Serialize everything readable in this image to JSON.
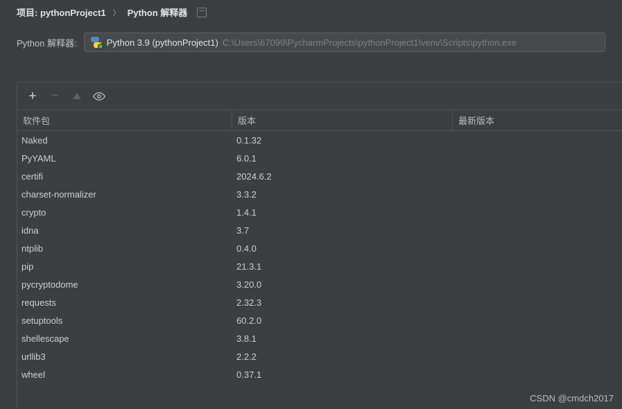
{
  "breadcrumb": {
    "project_label": "项目: pythonProject1",
    "current_page": "Python 解释器"
  },
  "interpreter": {
    "row_label": "Python 解释器:",
    "name": "Python 3.9 (pythonProject1)",
    "path": "C:\\Users\\67099\\PycharmProjects\\pythonProject1\\venv\\Scripts\\python.exe"
  },
  "toolbar": {
    "add": "+",
    "remove": "−"
  },
  "columns": {
    "package": "软件包",
    "version": "版本",
    "latest": "最新版本"
  },
  "packages": [
    {
      "name": "Naked",
      "version": "0.1.32"
    },
    {
      "name": "PyYAML",
      "version": "6.0.1"
    },
    {
      "name": "certifi",
      "version": "2024.6.2"
    },
    {
      "name": "charset-normalizer",
      "version": "3.3.2"
    },
    {
      "name": "crypto",
      "version": "1.4.1"
    },
    {
      "name": "idna",
      "version": "3.7"
    },
    {
      "name": "ntplib",
      "version": "0.4.0"
    },
    {
      "name": "pip",
      "version": "21.3.1"
    },
    {
      "name": "pycryptodome",
      "version": "3.20.0"
    },
    {
      "name": "requests",
      "version": "2.32.3"
    },
    {
      "name": "setuptools",
      "version": "60.2.0"
    },
    {
      "name": "shellescape",
      "version": "3.8.1"
    },
    {
      "name": "urllib3",
      "version": "2.2.2"
    },
    {
      "name": "wheel",
      "version": "0.37.1"
    }
  ],
  "watermark": "CSDN @cmdch2017"
}
